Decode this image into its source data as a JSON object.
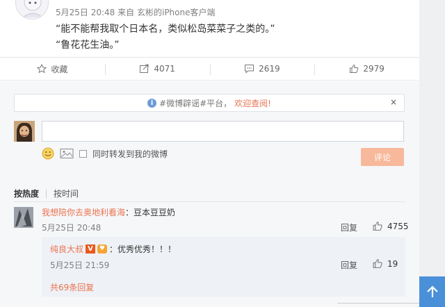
{
  "post": {
    "meta_date": "5月25日 20:48",
    "meta_from": "来自",
    "meta_source": "玄彬的iPhone客户端",
    "lines": [
      "“能不能帮我取个日本名，类似松岛菜菜子之类的。”",
      "“鲁花花生油。”"
    ]
  },
  "actions": {
    "favorite_label": "收藏",
    "repost_count": "4071",
    "comment_count": "2619",
    "like_count": "2979"
  },
  "notice": {
    "text": "#微博辟谣#平台，",
    "link": "欢迎查阅!",
    "close": "×"
  },
  "composer": {
    "input_value": "",
    "also_repost_label": "同时转发到我的微博",
    "submit_label": "评论"
  },
  "sort": {
    "by_hot": "按热度",
    "by_time": "按时间"
  },
  "comments": [
    {
      "user": "我想陪你去奥地利看海",
      "text": "：豆本豆豆奶",
      "time": "5月25日 20:48",
      "reply_label": "回复",
      "likes": "4755",
      "replies": [
        {
          "user": "纯良大叔",
          "badge_v": "V",
          "text": "：优秀优秀！！！",
          "time": "5月25日 21:59",
          "reply_label": "回复",
          "likes": "19"
        }
      ],
      "more_replies": "共69条回复"
    }
  ],
  "colors": {
    "link": "#eb7350",
    "submit_disabled": "#f7b89b",
    "scroll_top": "#4a90d9"
  }
}
